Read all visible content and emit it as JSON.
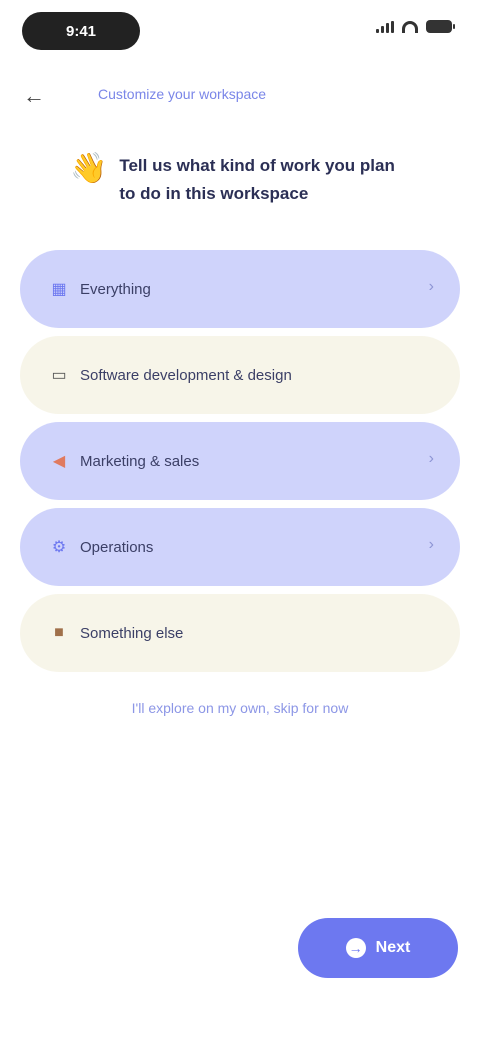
{
  "status_bar": {
    "time": "9:41"
  },
  "header": {
    "back_icon": "arrow-left-icon",
    "link": "Customize your workspace"
  },
  "prompt": {
    "icon": "👋",
    "text": "Tell us what kind of work you plan to do in this workspace"
  },
  "options": [
    {
      "label": "Everything",
      "icon": "grid-icon",
      "style": "blue",
      "chevron": true
    },
    {
      "label": "Software development & design",
      "icon": "laptop-icon",
      "style": "cream",
      "chevron": false
    },
    {
      "label": "Marketing & sales",
      "icon": "megaphone-icon",
      "style": "blue",
      "chevron": true
    },
    {
      "label": "Operations",
      "icon": "gear-icon",
      "style": "blue",
      "chevron": true
    },
    {
      "label": "Something else",
      "icon": "briefcase-icon",
      "style": "cream",
      "chevron": false
    }
  ],
  "footer": {
    "link": "I'll explore on my own, skip for now"
  },
  "fab": {
    "label": "Next",
    "icon": "arrow-right-icon"
  },
  "colors": {
    "accent": "#6d78f0",
    "option_blue": "#cfd3fb",
    "option_cream": "#f7f5e9"
  }
}
